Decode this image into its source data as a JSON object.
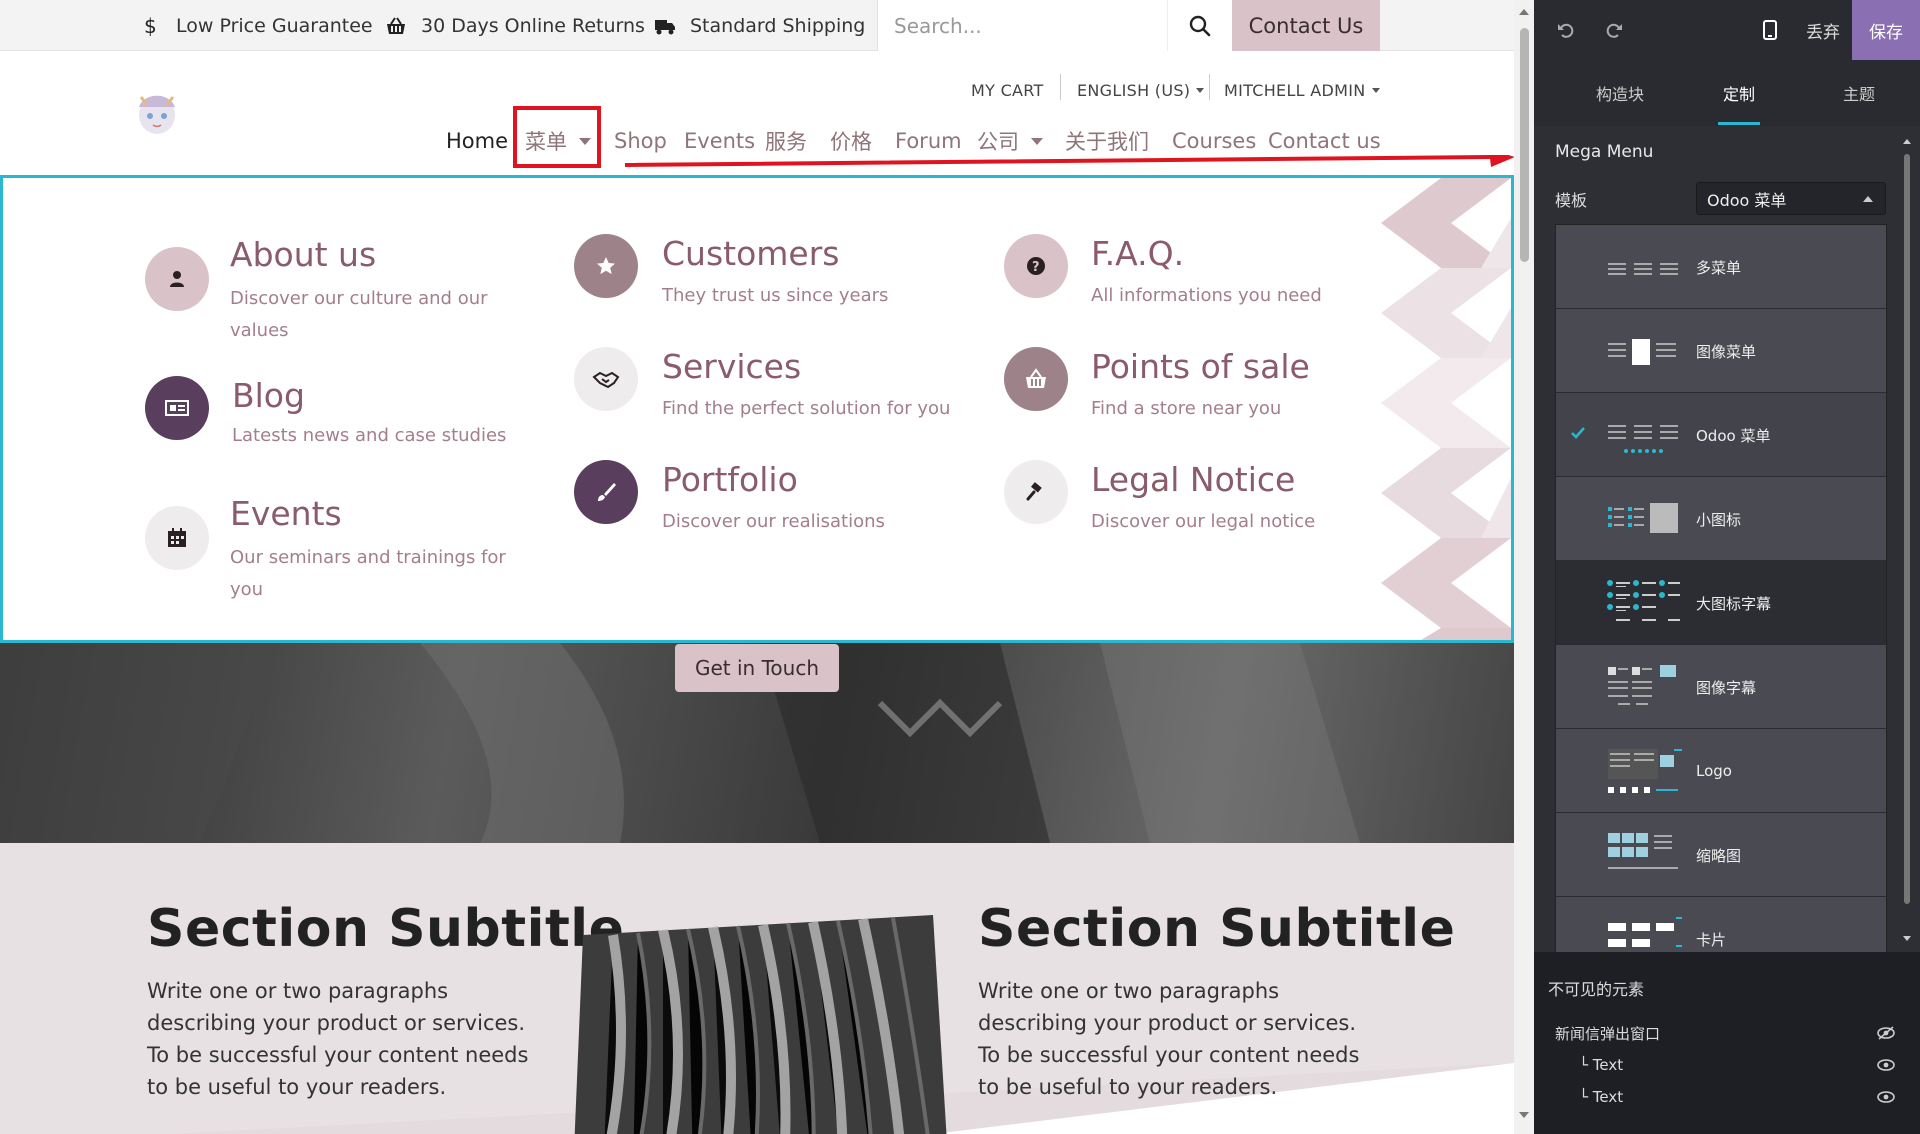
{
  "topbar": {
    "items": [
      {
        "label": "Low Price Guarantee",
        "icon": "dollar-icon"
      },
      {
        "label": "30 Days Online Returns",
        "icon": "basket-icon"
      },
      {
        "label": "Standard Shipping",
        "icon": "truck-icon"
      }
    ],
    "search_placeholder": "Search...",
    "contact_label": "Contact Us"
  },
  "header": {
    "sub_nav": [
      "MY CART",
      "ENGLISH (US)",
      "MITCHELL ADMIN"
    ],
    "main_nav": [
      "Home",
      "菜单",
      "Shop",
      "Events",
      "服务",
      "价格",
      "Forum",
      "公司",
      "关于我们",
      "Courses",
      "Contact us"
    ]
  },
  "mega_menu": {
    "items": [
      {
        "title": "About us",
        "desc": "Discover our culture and our values",
        "icon": "user-icon"
      },
      {
        "title": "Customers",
        "desc": "They trust us since years",
        "icon": "star-icon"
      },
      {
        "title": "F.A.Q.",
        "desc": "All informations you need",
        "icon": "question-icon"
      },
      {
        "title": "Blog",
        "desc": "Latests news and case studies",
        "icon": "newspaper-icon"
      },
      {
        "title": "Services",
        "desc": "Find the perfect solution for you",
        "icon": "handshake-icon"
      },
      {
        "title": "Points of sale",
        "desc": "Find a store near you",
        "icon": "basket-icon"
      },
      {
        "title": "Events",
        "desc": "Our seminars and trainings for you",
        "icon": "calendar-icon"
      },
      {
        "title": "Portfolio",
        "desc": "Discover our realisations",
        "icon": "paintbrush-icon"
      },
      {
        "title": "Legal Notice",
        "desc": "Discover our legal notice",
        "icon": "gavel-icon"
      }
    ]
  },
  "hero": {
    "button_label": "Get in Touch"
  },
  "section": {
    "left_title": "Section Subtitle",
    "left_text": "Write one or two paragraphs describing your product or services. To be successful your content needs to be useful to your readers.",
    "right_title": "Section Subtitle",
    "right_text": "Write one or two paragraphs describing your product or services. To be successful your content needs to be useful to your readers."
  },
  "panel": {
    "discard_label": "丢弃",
    "save_label": "保存",
    "tabs": [
      "构造块",
      "定制",
      "主题"
    ],
    "active_tab": "定制",
    "section_title": "Mega Menu",
    "template_label": "模板",
    "template_value": "Odoo 菜单",
    "options": [
      "多菜单",
      "图像菜单",
      "Odoo 菜单",
      "小图标",
      "大图标字幕",
      "图像字幕",
      "Logo",
      "缩略图",
      "卡片"
    ],
    "selected_option": "Odoo 菜单",
    "invisible_title": "不可见的元素",
    "invisible_items": [
      "新闻信弹出窗口",
      "└ Text",
      "└ Text"
    ]
  },
  "colors": {
    "accent_cyan": "#2ab8d0",
    "brand_pink": "#d9c3c9",
    "title_mauve": "#8a5b69",
    "save_purple": "#8a6fb3",
    "highlight_red": "#e0141e"
  }
}
